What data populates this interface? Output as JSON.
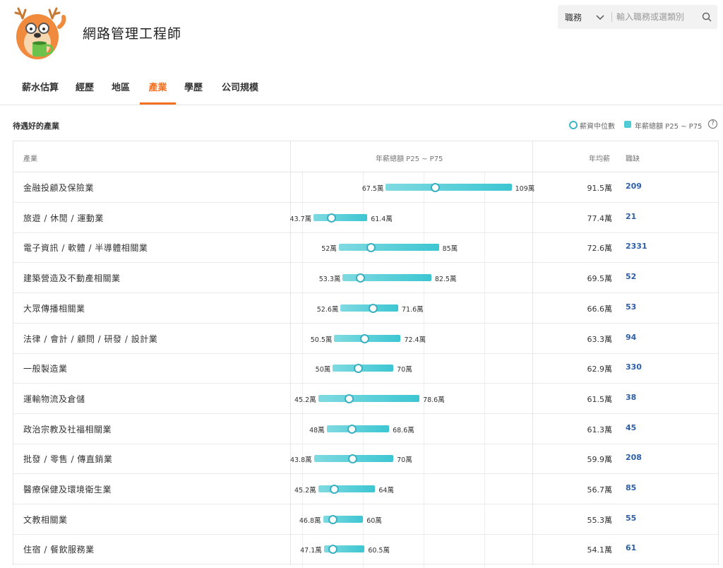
{
  "header": {
    "job_title": "網路管理工程師",
    "search": {
      "category": "職務",
      "placeholder": "輸入職務或選類別"
    }
  },
  "tabs": [
    {
      "label": "薪水估算",
      "active": false
    },
    {
      "label": "經歷",
      "active": false
    },
    {
      "label": "地區",
      "active": false
    },
    {
      "label": "產業",
      "active": true
    },
    {
      "label": "學歷",
      "active": false
    },
    {
      "label": "公司規模",
      "active": false
    }
  ],
  "section": {
    "title": "待遇好的產業",
    "legend_median": "薪資中位數",
    "legend_range": "年薪總額 P25 ~ P75",
    "help": "?"
  },
  "table": {
    "headers": {
      "industry": "產業",
      "range": "年薪總額 P25 ~ P75",
      "avg": "年均薪",
      "openings": "職缺"
    },
    "rows": [
      {
        "industry": "金融投顧及保險業",
        "p25": 67.5,
        "p75": 109,
        "median": 83.8,
        "p25_label": "67.5萬",
        "p75_label": "109萬",
        "avg": "91.5萬",
        "openings": "209"
      },
      {
        "industry": "旅遊 / 休閒 / 運動業",
        "p25": 43.7,
        "p75": 61.4,
        "median": 49.5,
        "p25_label": "43.7萬",
        "p75_label": "61.4萬",
        "avg": "77.4萬",
        "openings": "21"
      },
      {
        "industry": "電子資訊 / 軟體 / 半導體相關業",
        "p25": 52,
        "p75": 85,
        "median": 62.6,
        "p25_label": "52萬",
        "p75_label": "85萬",
        "avg": "72.6萬",
        "openings": "2331"
      },
      {
        "industry": "建築營造及不動產相關業",
        "p25": 53.3,
        "p75": 82.5,
        "median": 59,
        "p25_label": "53.3萬",
        "p75_label": "82.5萬",
        "avg": "69.5萬",
        "openings": "52"
      },
      {
        "industry": "大眾傳播相關業",
        "p25": 52.6,
        "p75": 71.6,
        "median": 63.3,
        "p25_label": "52.6萬",
        "p75_label": "71.6萬",
        "avg": "66.6萬",
        "openings": "53"
      },
      {
        "industry": "法律 / 會計 / 顧問 / 研發 / 設計業",
        "p25": 50.5,
        "p75": 72.4,
        "median": 60.5,
        "p25_label": "50.5萬",
        "p75_label": "72.4萬",
        "avg": "63.3萬",
        "openings": "94"
      },
      {
        "industry": "一般製造業",
        "p25": 50,
        "p75": 70,
        "median": 58.3,
        "p25_label": "50萬",
        "p75_label": "70萬",
        "avg": "62.9萬",
        "openings": "330"
      },
      {
        "industry": "運輸物流及倉儲",
        "p25": 45.2,
        "p75": 78.6,
        "median": 55.2,
        "p25_label": "45.2萬",
        "p75_label": "78.6萬",
        "avg": "61.5萬",
        "openings": "38"
      },
      {
        "industry": "政治宗教及社福相關業",
        "p25": 48,
        "p75": 68.6,
        "median": 56.2,
        "p25_label": "48萬",
        "p75_label": "68.6萬",
        "avg": "61.3萬",
        "openings": "45"
      },
      {
        "industry": "批發 / 零售 / 傳直銷業",
        "p25": 43.8,
        "p75": 70,
        "median": 56.5,
        "p25_label": "43.8萬",
        "p75_label": "70萬",
        "avg": "59.9萬",
        "openings": "208"
      },
      {
        "industry": "醫療保健及環境衛生業",
        "p25": 45.2,
        "p75": 64,
        "median": 50.5,
        "p25_label": "45.2萬",
        "p75_label": "64萬",
        "avg": "56.7萬",
        "openings": "85"
      },
      {
        "industry": "文教相關業",
        "p25": 46.8,
        "p75": 60,
        "median": 50,
        "p25_label": "46.8萬",
        "p75_label": "60萬",
        "avg": "55.3萬",
        "openings": "55"
      },
      {
        "industry": "住宿 / 餐飲服務業",
        "p25": 47.1,
        "p75": 60.5,
        "median": 50,
        "p25_label": "47.1萬",
        "p75_label": "60.5萬",
        "avg": "54.1萬",
        "openings": "61"
      }
    ]
  },
  "colors": {
    "accent": "#f37021",
    "bar": "#4ecbd6",
    "link": "#2d5fa8"
  }
}
